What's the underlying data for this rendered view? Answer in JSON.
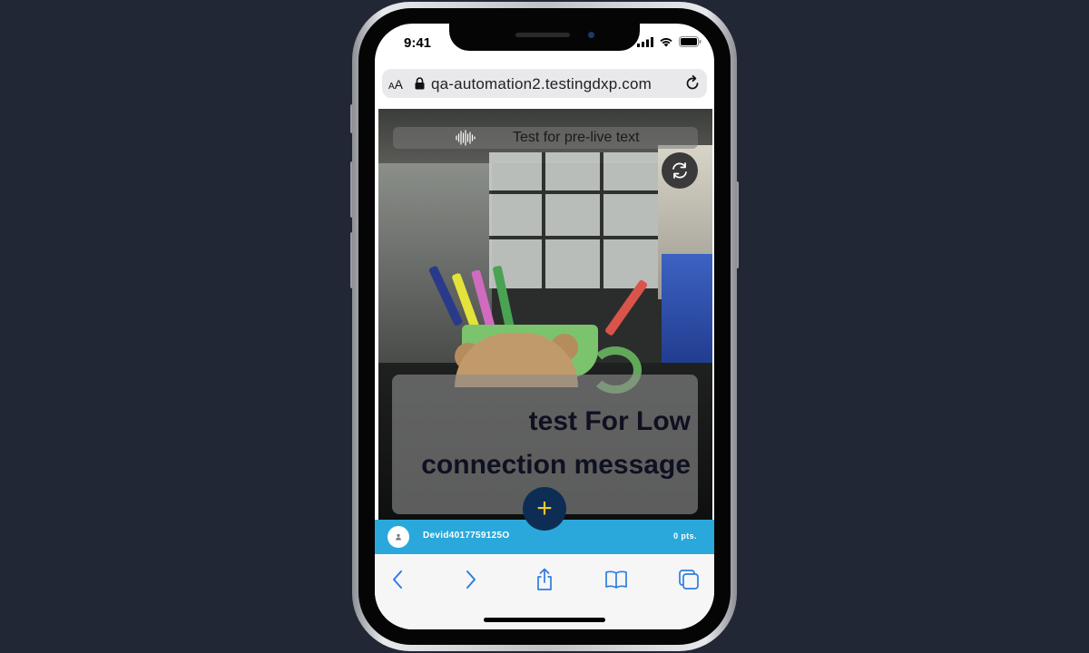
{
  "status_bar": {
    "time": "9:41"
  },
  "browser": {
    "text_size_button": "AA",
    "url": "qa-automation2.testingdxp.com"
  },
  "stream": {
    "pre_live_text": "Test for pre-live text",
    "low_connection_message": "test For Low connection message"
  },
  "user_bar": {
    "user_id": "Devid4017759125O",
    "points": "0 pts."
  },
  "icons": {
    "signal": "cellular-signal-icon",
    "wifi": "wifi-icon",
    "battery": "battery-icon",
    "lock": "lock-icon",
    "reload": "reload-icon",
    "waveform": "audio-waveform-icon",
    "flip_camera": "flip-camera-icon",
    "add": "plus-icon",
    "avatar": "user-avatar-icon",
    "back": "chevron-left-icon",
    "forward": "chevron-right-icon",
    "share": "share-icon",
    "bookmarks": "book-icon",
    "tabs": "tabs-icon"
  },
  "colors": {
    "background": "#222736",
    "user_bar": "#2aa8dc",
    "fab": "#0d2d55",
    "fab_plus": "#f2c62f",
    "ios_blue": "#2f7de1"
  }
}
